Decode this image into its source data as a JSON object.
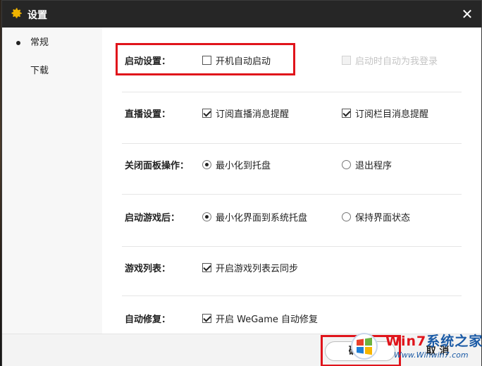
{
  "window": {
    "title": "设置",
    "close_glyph": "✕"
  },
  "sidebar": {
    "items": [
      {
        "label": "常规",
        "active": true
      },
      {
        "label": "下载",
        "active": false
      }
    ]
  },
  "settings": {
    "startup": {
      "label": "启动设置：",
      "options": [
        {
          "label": "开机自动启动",
          "type": "checkbox",
          "checked": false,
          "disabled": false
        },
        {
          "label": "启动时自动为我登录",
          "type": "checkbox",
          "checked": false,
          "disabled": true
        }
      ]
    },
    "live": {
      "label": "直播设置：",
      "options": [
        {
          "label": "订阅直播消息提醒",
          "type": "checkbox",
          "checked": true
        },
        {
          "label": "订阅栏目消息提醒",
          "type": "checkbox",
          "checked": true
        }
      ]
    },
    "close_panel": {
      "label": "关闭面板操作：",
      "options": [
        {
          "label": "最小化到托盘",
          "type": "radio",
          "checked": true
        },
        {
          "label": "退出程序",
          "type": "radio",
          "checked": false
        }
      ]
    },
    "after_game_launch": {
      "label": "启动游戏后：",
      "options": [
        {
          "label": "最小化界面到系统托盘",
          "type": "radio",
          "checked": true
        },
        {
          "label": "保持界面状态",
          "type": "radio",
          "checked": false
        }
      ]
    },
    "game_list": {
      "label": "游戏列表：",
      "options": [
        {
          "label": "开启游戏列表云同步",
          "type": "checkbox",
          "checked": true
        }
      ]
    },
    "auto_repair": {
      "label": "自动修复：",
      "options": [
        {
          "label": "开启 WeGame 自动修复",
          "type": "checkbox",
          "checked": true
        }
      ]
    }
  },
  "footer": {
    "confirm_label": "确 定",
    "cancel_label": "取 消"
  },
  "watermark": {
    "title_prefix": "Win7",
    "title_suffix": "系统之家",
    "url": "Www.Winwin7.com"
  },
  "colors": {
    "titlebar": "#262626",
    "highlight": "#e0141b",
    "gear": "#f0b400"
  },
  "icons": {
    "title": "gear-icon",
    "close": "close-icon",
    "nav_active": "bullet-icon"
  }
}
